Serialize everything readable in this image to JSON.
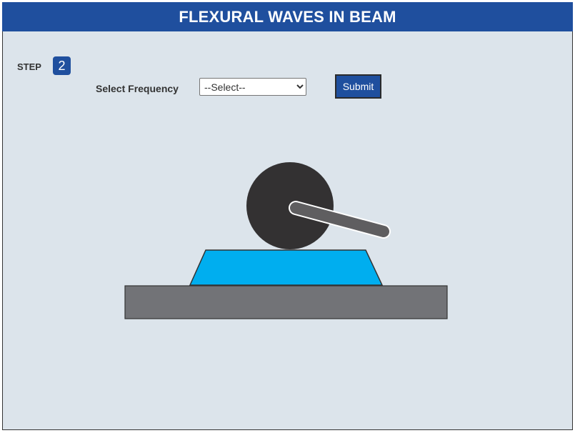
{
  "header": {
    "title": "FLEXURAL WAVES IN BEAM"
  },
  "step": {
    "label": "STEP",
    "number": "2"
  },
  "frequency": {
    "label": "Select Frequency",
    "selected": "--Select--",
    "options": [
      "--Select--"
    ]
  },
  "submit": {
    "label": "Submit"
  },
  "colors": {
    "header_bg": "#1f4f9e",
    "panel_bg": "#dce4eb",
    "mount_blue": "#00aeef",
    "base_gray": "#727377",
    "wheel_dark": "#333132",
    "arm_gray": "#5f5e60"
  }
}
